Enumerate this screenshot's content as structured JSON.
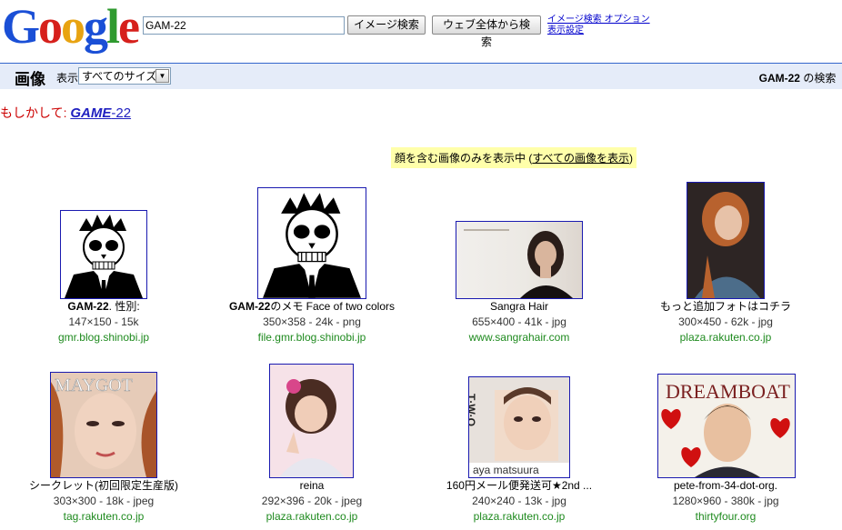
{
  "logo_text": "Google",
  "search": {
    "value": "GAM-22"
  },
  "buttons": {
    "image_search": "イメージ検索",
    "web_search": "ウェブ全体から検索"
  },
  "links": {
    "options": "イメージ検索 オプション",
    "display": "表示設定"
  },
  "bar": {
    "title": "画像",
    "show_label": "表示",
    "size_select": "すべてのサイズ",
    "query": "GAM-22",
    "query_suffix": " の検索"
  },
  "didyoumean": {
    "prefix": "もしかして: ",
    "bold": "GAME",
    "rest": "-22"
  },
  "notice": {
    "text": "顔を含む画像のみを表示中 (",
    "link": "すべての画像を表示",
    "end": ")"
  },
  "results": [
    {
      "title_bold": "GAM-22",
      "title_rest": ". 性別:",
      "meta": "147×150 - 15k",
      "url": "gmr.blog.shinobi.jp"
    },
    {
      "title_bold": "GAM-22",
      "title_rest": "のメモ Face of two colors",
      "meta": "350×358 - 24k - png",
      "url": "file.gmr.blog.shinobi.jp"
    },
    {
      "title_bold": "",
      "title_rest": "Sangra Hair",
      "meta": "655×400 - 41k - jpg",
      "url": "www.sangrahair.com"
    },
    {
      "title_bold": "",
      "title_rest": "もっと追加フォトはコチラ",
      "meta": "300×450 - 62k - jpg",
      "url": "plaza.rakuten.co.jp"
    },
    {
      "title_bold": "",
      "title_rest": "シークレット(初回限定生産版)",
      "meta": "303×300 - 18k - jpeg",
      "url": "tag.rakuten.co.jp"
    },
    {
      "title_bold": "",
      "title_rest": "reina",
      "meta": "292×396 - 20k - jpeg",
      "url": "plaza.rakuten.co.jp"
    },
    {
      "title_bold": "",
      "title_rest": "160円メール便発送可★2nd ...",
      "meta": "240×240 - 13k - jpg",
      "url": "plaza.rakuten.co.jp"
    },
    {
      "title_bold": "",
      "title_rest": "pete-from-34-dot-org.",
      "meta": "1280×960 - 380k - jpg",
      "url": "thirtyfour.org"
    }
  ],
  "thumb_text": {
    "t4_word": "MAYGOT",
    "t7_left": "T·W·O",
    "t7_bottom": "aya matsuura",
    "t8_top": "DREAMBOAT"
  }
}
